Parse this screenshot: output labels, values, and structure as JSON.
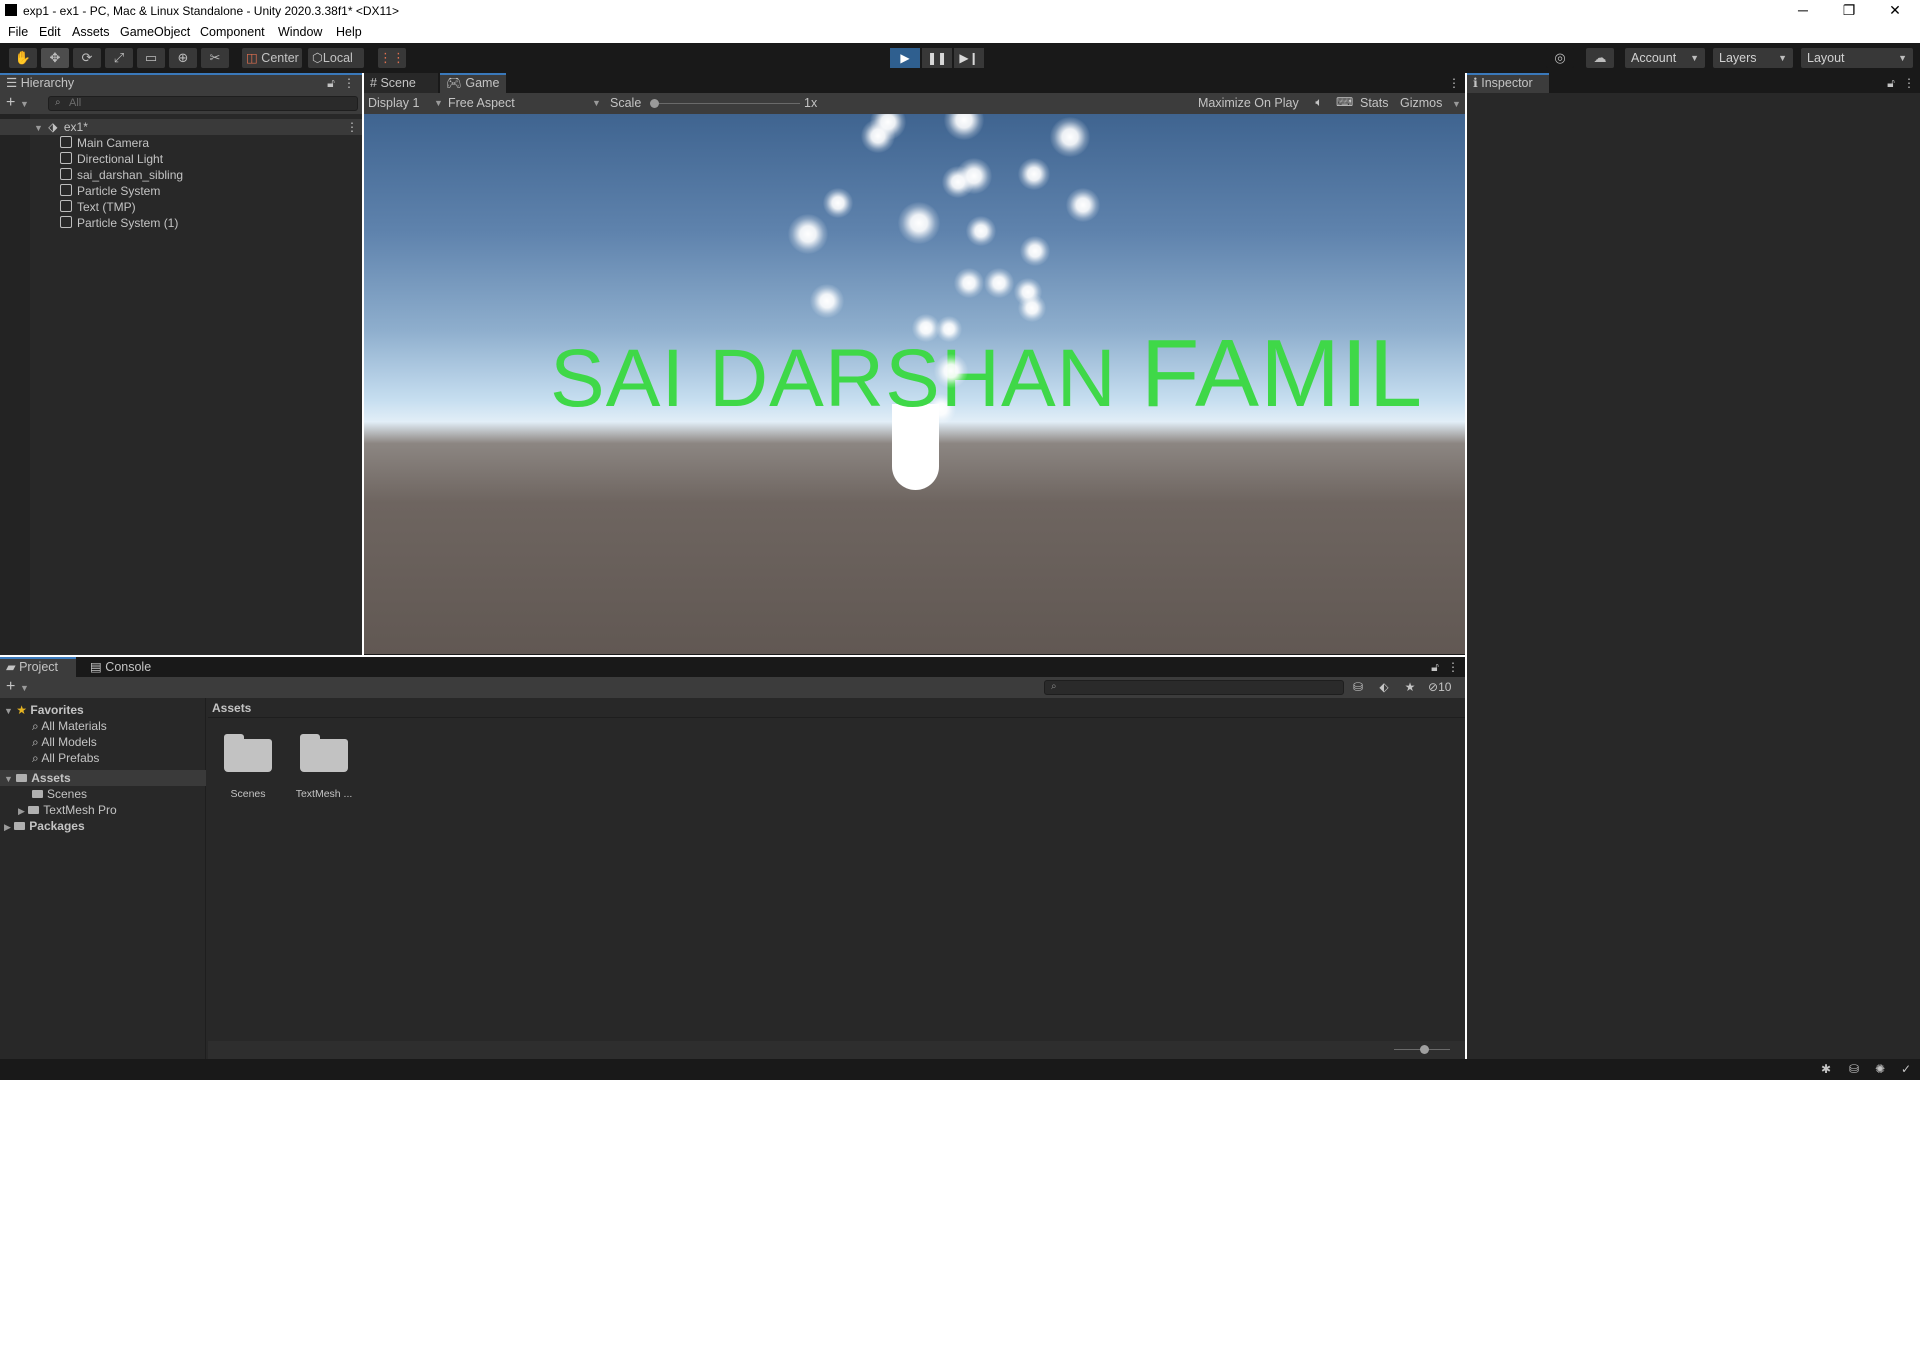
{
  "window": {
    "title": "exp1 - ex1 - PC, Mac & Linux Standalone - Unity 2020.3.38f1* <DX11>",
    "minimize": "─",
    "restore": "❐",
    "close": "✕"
  },
  "menu": [
    "File",
    "Edit",
    "Assets",
    "GameObject",
    "Component",
    "Window",
    "Help"
  ],
  "toolbar": {
    "tools": [
      {
        "name": "hand-tool",
        "glyph": "✋"
      },
      {
        "name": "move-tool",
        "glyph": "✥"
      },
      {
        "name": "rotate-tool",
        "glyph": "⟳"
      },
      {
        "name": "scale-tool",
        "glyph": "⤢"
      },
      {
        "name": "rect-tool",
        "glyph": "▭"
      },
      {
        "name": "transform-tool",
        "glyph": "⊕"
      },
      {
        "name": "custom-tool",
        "glyph": "✂"
      }
    ],
    "pivot_label": "Center",
    "space_label": "Local",
    "play": "▶",
    "pause": "❚❚",
    "step": "▶❙",
    "account_label": "Account",
    "layers_label": "Layers",
    "layout_label": "Layout",
    "accent": "#2f5f8f"
  },
  "hierarchy": {
    "tab_label": "Hierarchy",
    "add": "+",
    "search_placeholder": "All",
    "scene_name": "ex1*",
    "items": [
      "Main Camera",
      "Directional Light",
      "sai_darshan_sibling",
      "Particle System",
      "Text (TMP)",
      "Particle System (1)"
    ]
  },
  "viewtabs": {
    "scene_tab": "Scene",
    "game_tab": "Game",
    "display_label": "Display 1",
    "aspect_label": "Free Aspect",
    "scale_label": "Scale",
    "scale_value": "1x",
    "maximize_label": "Maximize On Play",
    "stats_label": "Stats",
    "gizmos_label": "Gizmos"
  },
  "game": {
    "text_main": "SAI DARSHAN ",
    "text_tail": "FAMIL",
    "text_color": "#3fd848"
  },
  "inspector": {
    "tab_label": "Inspector"
  },
  "project": {
    "project_tab": "Project",
    "console_tab": "Console",
    "add": "+",
    "hidden_count": "10",
    "favorites_label": "Favorites",
    "favorites": [
      "All Materials",
      "All Models",
      "All Prefabs"
    ],
    "assets_label": "Assets",
    "assets_children": [
      "Scenes",
      "TextMesh Pro"
    ],
    "packages_label": "Packages",
    "breadcrumb": "Assets",
    "tiles": [
      "Scenes",
      "TextMesh ..."
    ]
  }
}
